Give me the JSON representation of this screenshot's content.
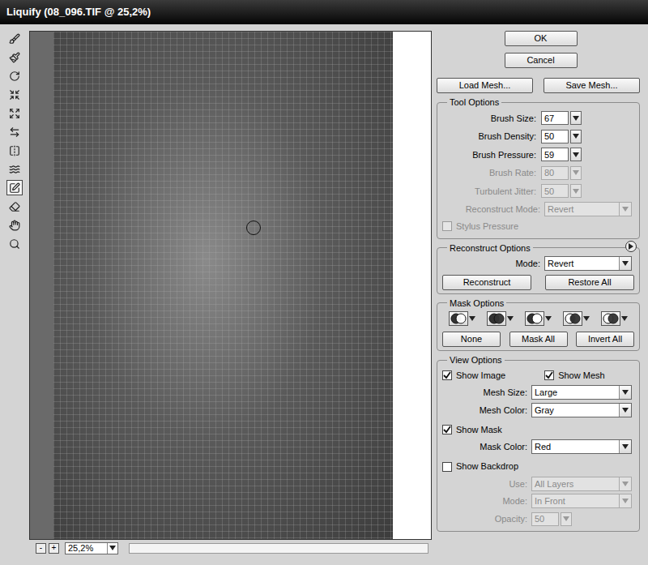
{
  "window": {
    "title": "Liquify (08_096.TIF @ 25,2%)"
  },
  "tools": [
    {
      "kind": "warp",
      "selected": false
    },
    {
      "kind": "reconstruct",
      "selected": false
    },
    {
      "kind": "twirl",
      "selected": false
    },
    {
      "kind": "pucker",
      "selected": false
    },
    {
      "kind": "bloat",
      "selected": false
    },
    {
      "kind": "push",
      "selected": false
    },
    {
      "kind": "mirror",
      "selected": false
    },
    {
      "kind": "turbulence",
      "selected": false
    },
    {
      "kind": "freeze",
      "selected": true
    },
    {
      "kind": "thaw",
      "selected": false
    },
    {
      "kind": "hand",
      "selected": false
    },
    {
      "kind": "zoom",
      "selected": false
    }
  ],
  "zoom": {
    "minus": "-",
    "plus": "+",
    "value": "25,2%"
  },
  "buttons": {
    "ok": "OK",
    "cancel": "Cancel",
    "load_mesh": "Load Mesh...",
    "save_mesh": "Save Mesh..."
  },
  "tool_options": {
    "title": "Tool Options",
    "fields": [
      {
        "label": "Brush Size:",
        "value": "67",
        "disabled": false
      },
      {
        "label": "Brush Density:",
        "value": "50",
        "disabled": false
      },
      {
        "label": "Brush Pressure:",
        "value": "59",
        "disabled": false
      },
      {
        "label": "Brush Rate:",
        "value": "80",
        "disabled": true
      },
      {
        "label": "Turbulent Jitter:",
        "value": "50",
        "disabled": true
      }
    ],
    "reconstruct_mode": {
      "label": "Reconstruct Mode:",
      "value": "Revert",
      "disabled": true
    },
    "stylus_pressure": {
      "label": "Stylus Pressure",
      "checked": false,
      "disabled": true
    }
  },
  "reconstruct_options": {
    "title": "Reconstruct Options",
    "mode": {
      "label": "Mode:",
      "value": "Revert"
    },
    "buttons": [
      "Reconstruct",
      "Restore All"
    ]
  },
  "mask_options": {
    "title": "Mask Options",
    "modes": [
      {
        "kind": "replace"
      },
      {
        "kind": "add"
      },
      {
        "kind": "subtract"
      },
      {
        "kind": "intersect"
      },
      {
        "kind": "invert"
      }
    ],
    "buttons": [
      "None",
      "Mask All",
      "Invert All"
    ]
  },
  "view_options": {
    "title": "View Options",
    "show_image": {
      "label": "Show Image",
      "checked": true
    },
    "show_mesh": {
      "label": "Show Mesh",
      "checked": true
    },
    "mesh_size": {
      "label": "Mesh Size:",
      "value": "Large"
    },
    "mesh_color": {
      "label": "Mesh Color:",
      "value": "Gray"
    },
    "show_mask": {
      "label": "Show Mask",
      "checked": true
    },
    "mask_color": {
      "label": "Mask Color:",
      "value": "Red"
    },
    "show_backdrop": {
      "label": "Show Backdrop",
      "checked": false
    },
    "backdrop_fields": [
      {
        "label": "Use:",
        "value": "All Layers",
        "disabled": true
      },
      {
        "label": "Mode:",
        "value": "In Front",
        "disabled": true
      }
    ]
  },
  "opacity": {
    "label": "Opacity:",
    "value": "50",
    "disabled": true
  }
}
